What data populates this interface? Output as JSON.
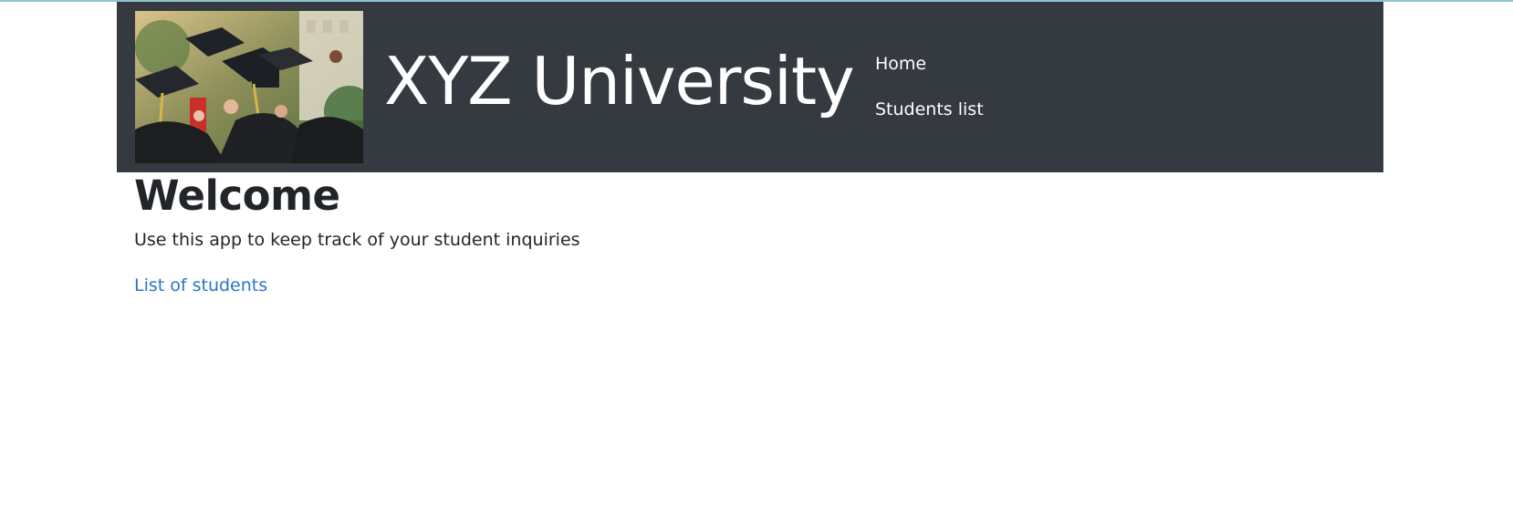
{
  "header": {
    "brand_title": "XYZ University",
    "hero_image": {
      "icon": "graduation-caps-photo",
      "alt": "Graduates tossing caps"
    },
    "nav": [
      {
        "label": "Home"
      },
      {
        "label": "Students list"
      }
    ]
  },
  "main": {
    "title": "Welcome",
    "description": "Use this app to keep track of your student inquiries",
    "link_label": "List of students"
  },
  "colors": {
    "navbar_bg": "#343a40",
    "text": "#212529",
    "link": "#2a75c9",
    "top_rule": "#8fc3cf"
  }
}
